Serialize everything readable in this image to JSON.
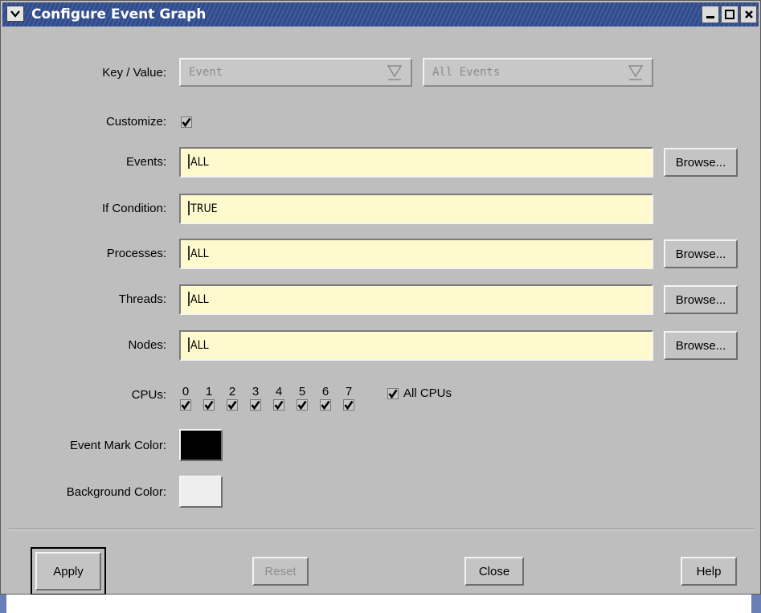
{
  "window": {
    "title": "Configure Event Graph"
  },
  "key_value": {
    "label": "Key / Value:",
    "key_select": "Event",
    "value_select": "All Events"
  },
  "customize": {
    "label": "Customize:",
    "checked": true
  },
  "fields": {
    "events": {
      "label": "Events:",
      "value": "ALL",
      "button": "Browse..."
    },
    "if_condition": {
      "label": "If Condition:",
      "value": "TRUE"
    },
    "processes": {
      "label": "Processes:",
      "value": "ALL",
      "button": "Browse..."
    },
    "threads": {
      "label": "Threads:",
      "value": "ALL",
      "button": "Browse..."
    },
    "nodes": {
      "label": "Nodes:",
      "value": "ALL",
      "button": "Browse..."
    }
  },
  "cpus": {
    "label": "CPUs:",
    "numbers": [
      "0",
      "1",
      "2",
      "3",
      "4",
      "5",
      "6",
      "7"
    ],
    "all_label": "All CPUs"
  },
  "colors": {
    "event_mark_label": "Event Mark Color:",
    "event_mark_value": "#000000",
    "background_label": "Background Color:",
    "background_value": "#eeeeee"
  },
  "buttons": {
    "apply": "Apply",
    "reset": "Reset",
    "close": "Close",
    "help": "Help"
  },
  "theme": {
    "titlebar": "#2f4b8c",
    "dialog_bg": "#bebebe",
    "field_bg": "#fffacd"
  }
}
